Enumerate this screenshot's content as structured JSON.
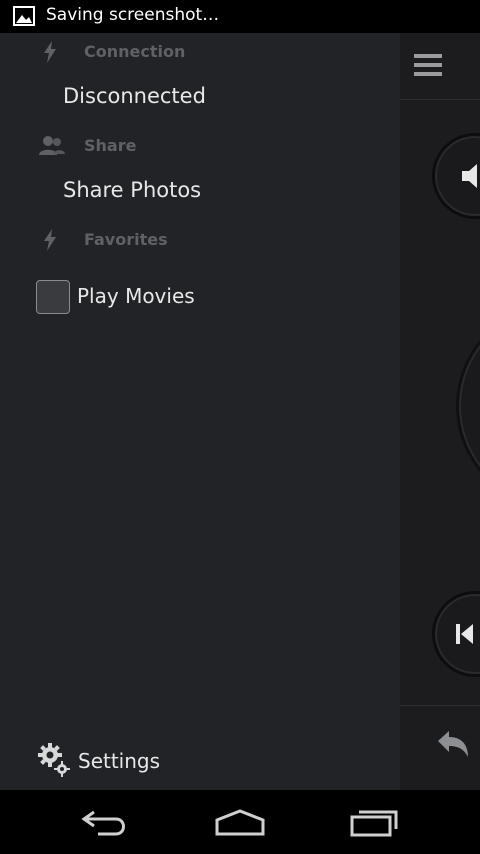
{
  "status_bar": {
    "notification_icon": "image-icon",
    "text": "Saving screenshot…"
  },
  "drawer": {
    "sections": [
      {
        "header": "Connection",
        "icon": "bolt-icon",
        "item": "Disconnected"
      },
      {
        "header": "Share",
        "icon": "people-icon",
        "item": "Share Photos"
      },
      {
        "header": "Favorites",
        "icon": "bolt-icon"
      }
    ],
    "checkbox_item": {
      "label": "Play Movies",
      "checked": false
    },
    "settings": {
      "label": "Settings",
      "icon": "gear-icon"
    }
  },
  "main_panel": {
    "menu_icon": "hamburger-icon",
    "volume_icon": "speaker-icon",
    "previous_icon": "skip-previous-icon",
    "back_icon": "reply-arrow-icon"
  },
  "nav_bar": {
    "buttons": [
      "back-icon",
      "home-icon",
      "recent-apps-icon"
    ]
  },
  "colors": {
    "drawer_bg": "#222327",
    "section_header": "#5f6166",
    "item_text": "#e8e8e8"
  }
}
